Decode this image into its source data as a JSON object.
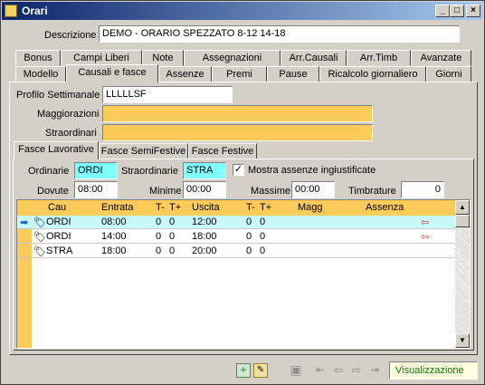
{
  "window": {
    "title": "Orari"
  },
  "header": {
    "descrizione_label": "Descrizione",
    "descrizione_value": "DEMO - ORARIO SPEZZATO 8-12 14-18"
  },
  "tabs_row1": [
    "Bonus",
    "Campi Liberi",
    "Note",
    "Assegnazioni",
    "Arr.Causali",
    "Arr.Timb",
    "Avanzate"
  ],
  "tabs_row2": [
    "Modello",
    "Causali e fasce",
    "Assenze",
    "Premi",
    "Pause",
    "Ricalcolo giornaliero",
    "Giorni"
  ],
  "profile": {
    "profilo_label": "Profilo Settimanale",
    "profilo_value": "LLLLLSF",
    "maggiorazioni_label": "Maggiorazioni",
    "maggiorazioni_value": "",
    "straordinari_label": "Straordinari",
    "straordinari_value": ""
  },
  "subtabs": [
    "Fasce Lavorative",
    "Fasce SemiFestive",
    "Fasce Festive"
  ],
  "filters": {
    "ordinarie_label": "Ordinarie",
    "ordinarie_value": "ORDI",
    "straordinarie_label": "Straordinarie",
    "straordinarie_value": "STRA",
    "mostra_label": "Mostra assenze ingiustificate",
    "mostra_checked": true,
    "dovute_label": "Dovute",
    "dovute_value": "08:00",
    "minime_label": "Minime",
    "minime_value": "00:00",
    "massime_label": "Massime",
    "massime_value": "00:00",
    "timbrature_label": "Timbrature",
    "timbrature_value": "0"
  },
  "grid": {
    "columns": [
      "Cau",
      "Entrata",
      "T-",
      "T+",
      "Uscita",
      "T-",
      "T+",
      "Magg",
      "Assenza"
    ],
    "rows": [
      {
        "cau": "ORDI",
        "entrata": "08:00",
        "tm1": "0",
        "tp1": "0",
        "uscita": "12:00",
        "tm2": "0",
        "tp2": "0",
        "magg": "",
        "assenza": ""
      },
      {
        "cau": "ORDI",
        "entrata": "14:00",
        "tm1": "0",
        "tp1": "0",
        "uscita": "18:00",
        "tm2": "0",
        "tp2": "0",
        "magg": "",
        "assenza": ""
      },
      {
        "cau": "STRA",
        "entrata": "18:00",
        "tm1": "0",
        "tp1": "0",
        "uscita": "20:00",
        "tm2": "0",
        "tp2": "0",
        "magg": "",
        "assenza": ""
      }
    ]
  },
  "status": {
    "mode": "Visualizzazione"
  },
  "colors": {
    "accent_yellow": "#fccb5a",
    "cyan": "#80ffff",
    "selected_row": "#c8f8f8",
    "status_green": "#008000"
  }
}
